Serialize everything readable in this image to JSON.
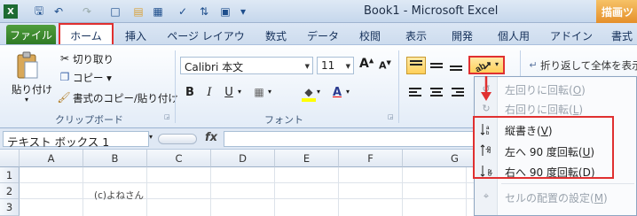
{
  "window": {
    "title": "Book1 - Microsoft Excel",
    "contextual_tab": "描画ツ"
  },
  "tabs": [
    {
      "label": "ファイル"
    },
    {
      "label": "ホーム"
    },
    {
      "label": "挿入"
    },
    {
      "label": "ページ レイアウト"
    },
    {
      "label": "数式"
    },
    {
      "label": "データ"
    },
    {
      "label": "校閲"
    },
    {
      "label": "表示"
    },
    {
      "label": "開発"
    },
    {
      "label": "個人用"
    },
    {
      "label": "アドイン"
    },
    {
      "label": "書式"
    }
  ],
  "clipboard": {
    "paste": "貼り付け",
    "cut": "切り取り",
    "copy": "コピー ▾",
    "format_painter": "書式のコピー/貼り付け",
    "group": "クリップボード"
  },
  "font": {
    "name": "Calibri 本文",
    "size": "11",
    "group": "フォント",
    "grow": "A",
    "shrink": "A",
    "bold": "B",
    "italic": "I",
    "underline": "U",
    "fontcolor_letter": "A"
  },
  "alignment": {
    "wrap_text": "折り返して全体を表示"
  },
  "formula_bar": {
    "name_box": "テキスト ボックス 1",
    "fx": "fx",
    "value": ""
  },
  "grid": {
    "columns": [
      "A",
      "B",
      "C",
      "D",
      "E",
      "F",
      "G"
    ],
    "rows": [
      "1",
      "2",
      "3"
    ],
    "cell_text": "(c)よねさん"
  },
  "menu": {
    "items": [
      {
        "label": "左回りに回転(",
        "key": "O",
        "end": ")",
        "enabled": false,
        "icon": "rotate-ccw-icon"
      },
      {
        "label": "右回りに回転(",
        "key": "L",
        "end": ")",
        "enabled": false,
        "icon": "rotate-cw-icon"
      },
      {
        "label": "縦書き(",
        "key": "V",
        "end": ")",
        "enabled": true,
        "icon": "vertical-text-icon"
      },
      {
        "label": "左へ 90 度回転(",
        "key": "U",
        "end": ")",
        "enabled": true,
        "icon": "rotate-up-icon"
      },
      {
        "label": "右へ 90 度回転(",
        "key": "D",
        "end": ")",
        "enabled": true,
        "icon": "rotate-down-icon"
      },
      {
        "label": "セルの配置の設定(",
        "key": "M",
        "end": ")",
        "enabled": false,
        "icon": "format-alignment-icon"
      }
    ]
  },
  "colors": {
    "accent_red": "#e03030",
    "file_tab": "#2f7a25",
    "ribbon_blue": "#dbe6f4"
  }
}
